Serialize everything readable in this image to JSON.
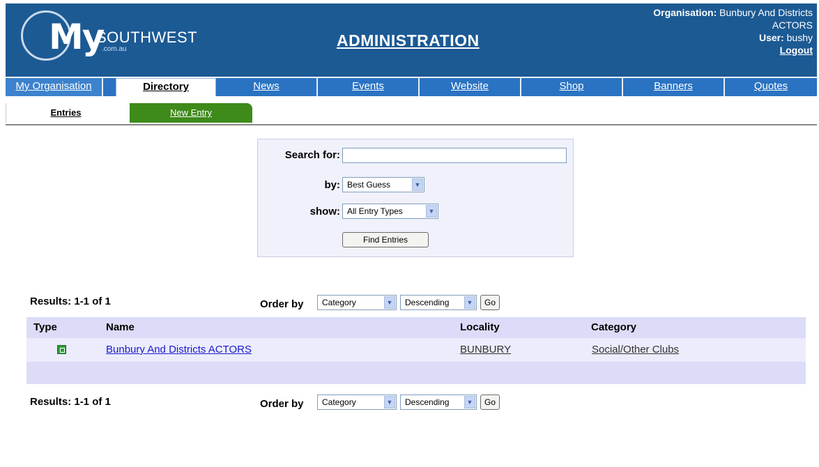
{
  "header": {
    "logo_my": "My",
    "logo_southwest": "SOUTHWEST",
    "logo_domain": ".com.au",
    "title": "ADMINISTRATION",
    "organisation_label": "Organisation:",
    "organisation_value_line1": "Bunbury And Districts",
    "organisation_value_line2": "ACTORS",
    "user_label": "User:",
    "user_value": "bushy",
    "logout_label": "Logout"
  },
  "tabs": [
    {
      "label": "My Organisation"
    },
    {
      "label": "Directory"
    },
    {
      "label": "News"
    },
    {
      "label": "Events"
    },
    {
      "label": "Website"
    },
    {
      "label": "Shop"
    },
    {
      "label": "Banners"
    },
    {
      "label": "Quotes"
    }
  ],
  "subtabs": {
    "entries": "Entries",
    "new_entry": "New Entry"
  },
  "search": {
    "search_for_label": "Search for:",
    "search_for_value": "",
    "by_label": "by:",
    "by_value": "Best Guess",
    "show_label": "show:",
    "show_value": "All Entry Types",
    "button_label": "Find Entries"
  },
  "results": {
    "top_text": "Results: 1-1 of 1",
    "bottom_text": "Results: 1-1 of 1",
    "order_by_label": "Order by",
    "order_field": "Category",
    "order_direction": "Descending",
    "go_label": "Go"
  },
  "table": {
    "columns": [
      "Type",
      "Name",
      "Locality",
      "Category"
    ],
    "rows": [
      {
        "type_icon": "listing-icon",
        "name": "Bunbury And Districts ACTORS",
        "locality": "BUNBURY",
        "category": "Social/Other Clubs"
      }
    ]
  },
  "colors": {
    "header_bg": "#1c5a94",
    "tab_bar_bg": "#2a73c2",
    "new_entry_tab": "#3e8a1a",
    "table_header_bg": "#dcdcf8",
    "table_row_bg": "#ececfc",
    "link": "#1a1acc"
  }
}
